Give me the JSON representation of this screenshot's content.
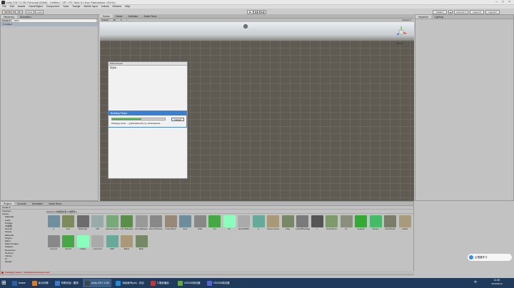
{
  "window": {
    "title": "Unity 2017.4.3f1 Personal (64bit) - Untitled - VR - PC, Mac & Linux Standalone <DX11>"
  },
  "menu": [
    "File",
    "Edit",
    "Assets",
    "GameObject",
    "Component",
    "Tools",
    "Tuanjie",
    "Mobile Input",
    "Vuforia",
    "Window",
    "Help"
  ],
  "toolbar": {
    "pivot": "Pivot",
    "local": "Local",
    "collab": "Collab ▾",
    "account": "Account ▾",
    "layers": "Layers ▾",
    "layout": "Layout ▾"
  },
  "hierarchy": {
    "tabs": [
      "Hierarchy",
      "Animation"
    ],
    "create": "Create ▾",
    "search_placeholder": "Q▾All",
    "scene": "Untitled"
  },
  "scene": {
    "tabs": [
      "Scene",
      "Game",
      "Animator",
      "Asset Store"
    ],
    "shaded": "Shaded",
    "mode": "2D",
    "gizmos": "Gizmos ▾",
    "view": "Persp"
  },
  "inspector": {
    "tabs": [
      "Inspector",
      "Lighting"
    ]
  },
  "build_settings": {
    "title": "Native Export",
    "sub": "导出中..."
  },
  "build": {
    "title": "Building Player",
    "status": "Packaging assets - ...jpgStandaloneVR_h1_0/sharedassets",
    "cancel": "Cancel",
    "progress": 0.55
  },
  "project": {
    "tabs": [
      "Project",
      "Console",
      "Animation",
      "Asset Store"
    ],
    "create": "Create ▾",
    "breadcrumb": "Assets ▸ 3D模型资源 ▸ 材质球 ▸ ...",
    "tree": [
      "Favorites",
      "Assets",
      "Materials",
      "Audio",
      "Prefabs",
      "3D模型",
      "Scenes",
      "Scripts",
      "Materials",
      "Plugins",
      "Editor",
      "Pillar Pendant",
      "Shaders",
      "Resources",
      "Textures",
      "Vuforia",
      "UI",
      "Models"
    ],
    "row1": [
      "a",
      "bed",
      "Materials",
      "stiff",
      "Heavenspace",
      "Lite Wallpape",
      "Lite Wallpape",
      "Floor Museum",
      "GreenFloor",
      "floor",
      "Wall",
      "xin",
      "ze",
      "ELE.06065",
      "b",
      "Grass Grass",
      "Flag",
      "Grass/Blockage",
      "c",
      "ColorStone",
      "tin",
      "asphalt",
      "Desert",
      "stoneblock",
      "cobble"
    ],
    "row2": [
      "cosmos",
      "stone4",
      "cobble",
      "cosmos4",
      "GRK",
      "Black",
      "Bear"
    ],
    "status": "Packaging assets - sharedassets0.assets.resS"
  },
  "taskbar": {
    "items": [
      "Ilmare",
      "私访问第",
      "听歌识曲 - 酷狗",
      "Unity 2017.4.3f1",
      "添加帐号(ad) - 总目",
      "3.搜索播放...",
      "VS2008调试器",
      "VS2008调试器"
    ],
    "clock": "11:26",
    "date": "2021/04/13",
    "lang": "中"
  },
  "overlay": {
    "label": "云搭建学习"
  }
}
